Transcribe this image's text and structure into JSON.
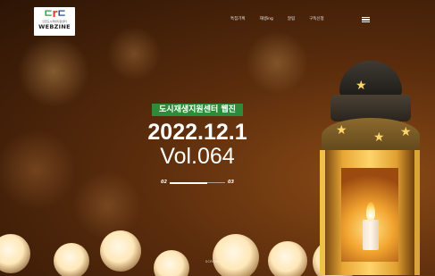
{
  "header": {
    "logo": {
      "mark_left": "ㄷ",
      "mark_mid": "r",
      "mark_right": "ㄷ",
      "subtitle": "인천도시재생지원센터",
      "wordmark": "WEBZINE"
    },
    "nav": [
      {
        "label": "특집기획"
      },
      {
        "label": "재생ing"
      },
      {
        "label": "알림"
      },
      {
        "label": "구독신청"
      }
    ],
    "menu_icon": "hamburger-icon"
  },
  "hero": {
    "badge": "도시재생지원센터 웹진",
    "date": "2022.12.1",
    "volume": "Vol.064",
    "pager": {
      "current": "02",
      "total": "03",
      "progress": 0.67
    },
    "scroll_text": "SCROLL"
  },
  "colors": {
    "badge_bg": "#2e8b3a",
    "logo_green": "#2e9e44",
    "logo_blue": "#2b4aa0"
  }
}
